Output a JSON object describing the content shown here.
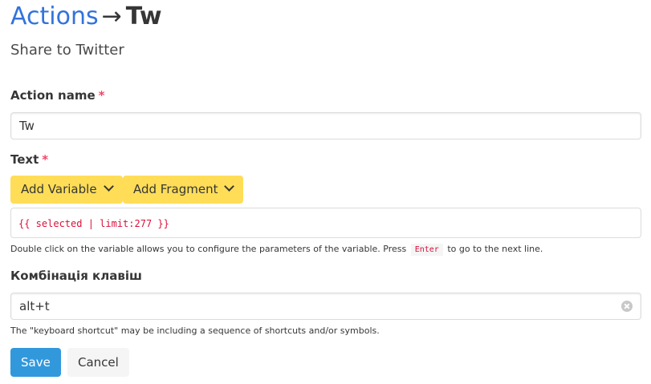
{
  "header": {
    "breadcrumb_link": "Actions",
    "arrow": "→",
    "current": "Tw",
    "subtitle": "Share to Twitter"
  },
  "form": {
    "action_name": {
      "label": "Action name",
      "required_mark": "*",
      "value": "Tw"
    },
    "text": {
      "label": "Text",
      "required_mark": "*",
      "add_variable_label": "Add Variable",
      "add_fragment_label": "Add Fragment",
      "value": "{{ selected | limit:277 }}",
      "help_before": "Double click on the variable allows you to configure the parameters of the variable. Press",
      "help_key": "Enter",
      "help_after": "to go to the next line."
    },
    "shortcut": {
      "label": "Комбінація клавіш",
      "value": "alt+t",
      "help": "The \"keyboard shortcut\" may be including a sequence of shortcuts and/or symbols."
    }
  },
  "buttons": {
    "save_label": "Save",
    "cancel_label": "Cancel"
  },
  "colors": {
    "link": "#3273dc",
    "required": "#f14668",
    "warning_button": "#ffdd57",
    "primary_button": "#3298dc",
    "code_text": "#da1039"
  },
  "icons": [
    "chevron-down-icon",
    "clear-icon"
  ]
}
